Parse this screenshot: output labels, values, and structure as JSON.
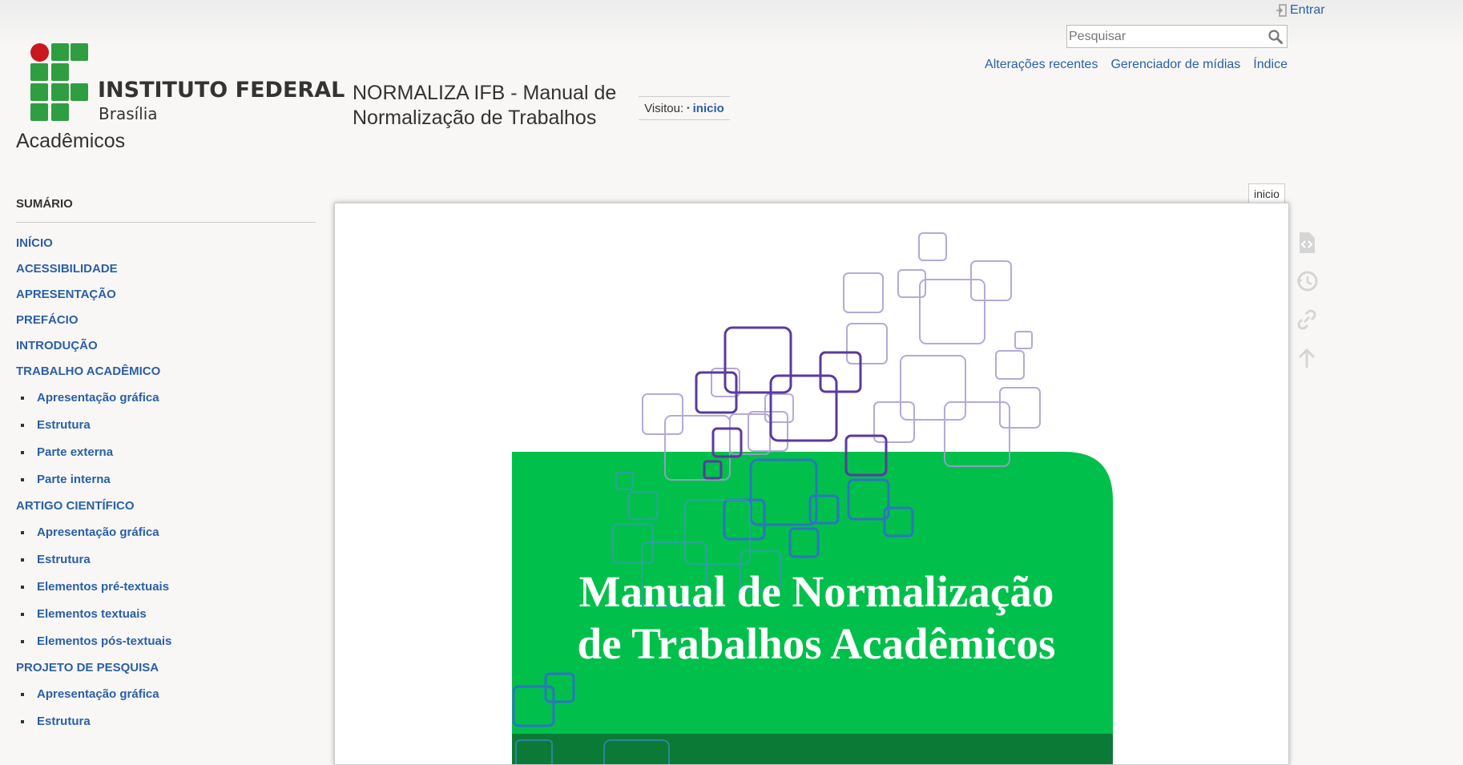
{
  "header": {
    "login_label": "Entrar",
    "search_placeholder": "Pesquisar",
    "tools": [
      {
        "label": "Alterações recentes"
      },
      {
        "label": "Gerenciador de mídias"
      },
      {
        "label": "Índice"
      }
    ],
    "logo_line1": "INSTITUTO FEDERAL",
    "logo_line2": "Brasília",
    "site_title_line1": "NORMALIZA IFB - Manual de Normalização de Trabalhos",
    "site_title_line2": "Acadêmicos",
    "trace_label": "Visitou:",
    "trace_link": "inicio"
  },
  "sidebar": {
    "title": "SUMÁRIO",
    "items": [
      {
        "label": "INÍCIO",
        "level": 1
      },
      {
        "label": "ACESSIBILIDADE",
        "level": 1
      },
      {
        "label": "APRESENTAÇÃO",
        "level": 1
      },
      {
        "label": "PREFÁCIO",
        "level": 1
      },
      {
        "label": "INTRODUÇÃO",
        "level": 1
      },
      {
        "label": "TRABALHO ACADÊMICO",
        "level": 1
      },
      {
        "label": "Apresentação gráfica",
        "level": 2
      },
      {
        "label": "Estrutura",
        "level": 2
      },
      {
        "label": "Parte externa",
        "level": 2
      },
      {
        "label": "Parte interna",
        "level": 2
      },
      {
        "label": "ARTIGO CIENTÍFICO",
        "level": 1
      },
      {
        "label": "Apresentação gráfica",
        "level": 2
      },
      {
        "label": "Estrutura",
        "level": 2
      },
      {
        "label": "Elementos pré-textuais",
        "level": 2
      },
      {
        "label": "Elementos textuais",
        "level": 2
      },
      {
        "label": "Elementos pós-textuais",
        "level": 2
      },
      {
        "label": "PROJETO DE PESQUISA",
        "level": 1
      },
      {
        "label": "Apresentação gráfica",
        "level": 2
      },
      {
        "label": "Estrutura",
        "level": 2
      }
    ]
  },
  "page": {
    "tab_label": "inicio",
    "cover_title_line1": "Manual de Normalização",
    "cover_title_line2": "de Trabalhos Acadêmicos"
  },
  "colors": {
    "link": "#2b5fa6",
    "cover_green": "#00c04b",
    "cover_dark_green": "#0a7a36",
    "purple": "#5a3a9e",
    "blue": "#2f74c0",
    "logo_green": "#2f9e41",
    "logo_red": "#c8191e"
  },
  "page_tools": [
    {
      "icon": "source-icon"
    },
    {
      "icon": "history-icon"
    },
    {
      "icon": "link-icon"
    },
    {
      "icon": "back-to-top-icon"
    }
  ]
}
